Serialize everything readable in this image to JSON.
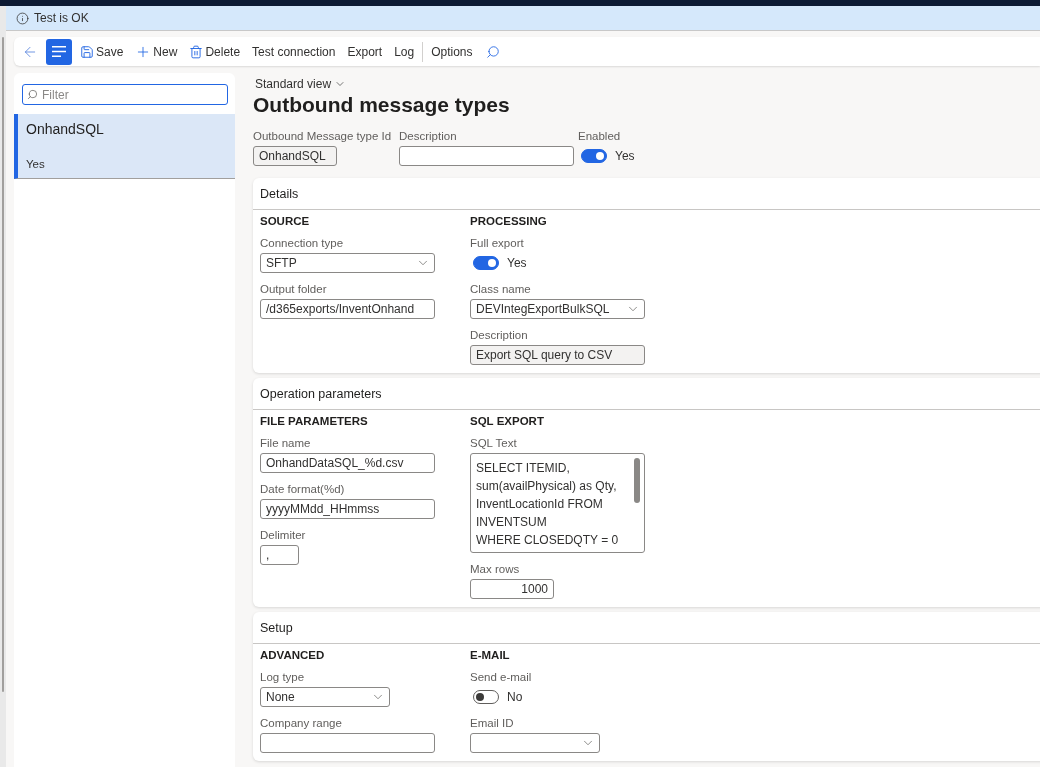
{
  "message_bar": {
    "text": "Test is OK"
  },
  "toolbar": {
    "list_pane_toggle": {
      "on": true
    },
    "actions": [
      {
        "kind": "save",
        "label": "Save"
      },
      {
        "kind": "new",
        "label": "New"
      },
      {
        "kind": "delete",
        "label": "Delete"
      },
      {
        "kind": "plain",
        "label": "Test connection"
      },
      {
        "kind": "plain",
        "label": "Export"
      },
      {
        "kind": "plain",
        "label": "Log"
      }
    ],
    "options": {
      "label": "Options"
    }
  },
  "list_pane": {
    "filter": {
      "placeholder": "Filter"
    },
    "items": [
      {
        "title": "OnhandSQL",
        "subtitle": "Yes",
        "selected": true
      }
    ]
  },
  "page": {
    "view_selector": "Standard view",
    "title": "Outbound message types"
  },
  "header_fields": [
    {
      "kind": "text",
      "label": "Outbound Message type Id",
      "value": "OnhandSQL",
      "read_only": true
    },
    {
      "kind": "text",
      "label": "Description",
      "read_only": false
    },
    {
      "kind": "toggle",
      "label": "Enabled",
      "on": true,
      "state_text": "Yes"
    }
  ],
  "sections": [
    {
      "title": "Details",
      "groups": [
        {
          "title": "SOURCE",
          "fields": [
            {
              "kind": "select",
              "label": "Connection type",
              "value": "SFTP"
            },
            {
              "kind": "text",
              "label": "Output folder",
              "value": "/d365exports/InventOnhand",
              "read_only": false
            }
          ]
        },
        {
          "title": "PROCESSING",
          "fields": [
            {
              "kind": "toggle",
              "label": "Full export",
              "on": true,
              "state_text": "Yes"
            },
            {
              "kind": "select",
              "label": "Class name",
              "value": "DEVIntegExportBulkSQL"
            },
            {
              "kind": "text",
              "label": "Description",
              "value": "Export SQL query to CSV",
              "read_only": true
            }
          ]
        }
      ]
    },
    {
      "title": "Operation parameters",
      "groups": [
        {
          "title": "FILE PARAMETERS",
          "fields": [
            {
              "kind": "text",
              "label": "File name",
              "value": "OnhandDataSQL_%d.csv",
              "read_only": false
            },
            {
              "kind": "text",
              "label": "Date format(%d)",
              "value": "yyyyMMdd_HHmmss",
              "read_only": false
            },
            {
              "kind": "text",
              "label": "Delimiter",
              "value": ",",
              "read_only": false
            }
          ]
        },
        {
          "title": "SQL EXPORT",
          "fields": [
            {
              "kind": "textarea",
              "label": "SQL Text",
              "value": "SELECT ITEMID,\nsum(availPhysical) as Qty,\nInventLocationId FROM\nINVENTSUM\nWHERE CLOSEDQTY = 0"
            },
            {
              "kind": "number",
              "label": "Max rows",
              "value": "1000",
              "read_only": false
            }
          ]
        }
      ]
    },
    {
      "title": "Setup",
      "groups": [
        {
          "title": "ADVANCED",
          "fields": [
            {
              "kind": "select",
              "label": "Log type",
              "value": "None"
            },
            {
              "kind": "text",
              "label": "Company range",
              "read_only": false
            }
          ]
        },
        {
          "title": "E-MAIL",
          "fields": [
            {
              "kind": "toggle",
              "label": "Send e-mail",
              "on": false,
              "state_text": "No"
            },
            {
              "kind": "select",
              "label": "Email ID"
            }
          ]
        }
      ]
    }
  ]
}
